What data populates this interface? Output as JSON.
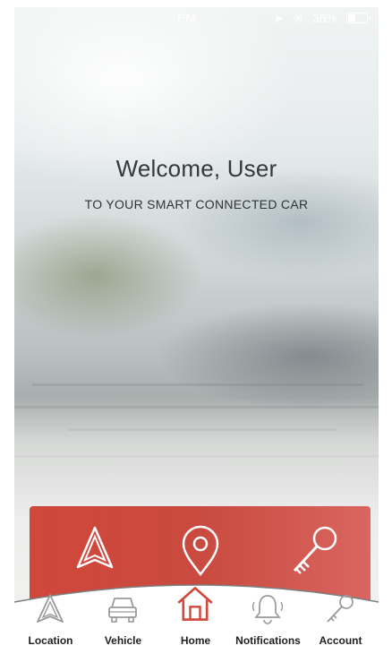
{
  "status_bar": {
    "time": "PM",
    "battery": "36%"
  },
  "welcome": {
    "title": "Welcome, User",
    "subtitle": "TO YOUR SMART CONNECTED CAR"
  },
  "action_panel": {
    "icons": [
      "navigation-arrow-icon",
      "location-pin-icon",
      "key-icon"
    ],
    "color": "#cf4a3e"
  },
  "tab_bar": {
    "tabs": [
      {
        "label": "Location",
        "icon": "navigation-arrow-icon"
      },
      {
        "label": "Vehicle",
        "icon": "car-icon"
      },
      {
        "label": "Home",
        "icon": "home-icon",
        "active": true
      },
      {
        "label": "Notifications",
        "icon": "bell-icon"
      },
      {
        "label": "Account",
        "icon": "key-icon"
      }
    ],
    "active_color": "#d0473b"
  }
}
